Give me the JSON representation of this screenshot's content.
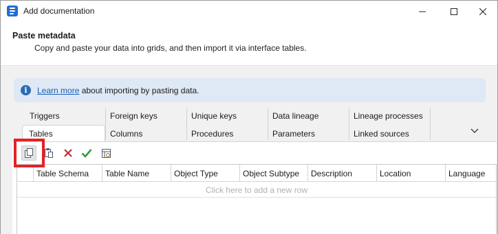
{
  "window": {
    "title": "Add documentation"
  },
  "header": {
    "title": "Paste metadata",
    "subtitle": "Copy and paste your data into grids, and then import it via interface tables."
  },
  "info": {
    "link_text": "Learn more",
    "text": " about importing by pasting data."
  },
  "tabs": {
    "row1": [
      "Triggers",
      "Foreign keys",
      "Unique keys",
      "Data lineage",
      "Lineage processes"
    ],
    "row2": [
      "Tables",
      "Columns",
      "Procedures",
      "Parameters",
      "Linked sources"
    ],
    "active": "Tables"
  },
  "toolbar": {
    "icons": [
      "copy-icon",
      "paste-icon",
      "delete-icon",
      "confirm-icon",
      "clear-icon"
    ]
  },
  "grid": {
    "columns": [
      "Table Schema",
      "Table Name",
      "Object Type",
      "Object Subtype",
      "Description",
      "Location",
      "Language"
    ],
    "new_row_text": "Click here to add a new row"
  },
  "colors": {
    "accent": "#1f6fd1",
    "highlight": "#e52125",
    "info_bg": "#dfe8f5",
    "delete": "#c82b2b",
    "confirm": "#2e9a3a"
  }
}
